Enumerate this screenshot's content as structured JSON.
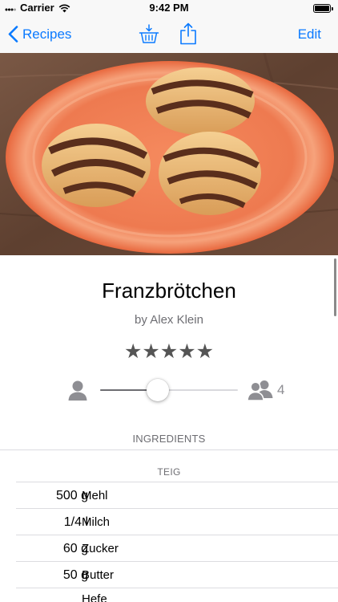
{
  "status_bar": {
    "carrier": "Carrier",
    "time": "9:42 PM"
  },
  "nav": {
    "back_label": "Recipes",
    "edit_label": "Edit"
  },
  "recipe": {
    "title": "Franzbrötchen",
    "author": "by Alex Klein",
    "stars": "★★★★★",
    "rating": 5
  },
  "servings": {
    "count": "4",
    "slider_fraction": 0.42
  },
  "ingredients": {
    "section_title": "INGREDIENTS",
    "groups": [
      {
        "name": "TEIG",
        "items": [
          {
            "amount": "500 g",
            "name": "Mehl"
          },
          {
            "amount": "1/4 l",
            "name": "Milch"
          },
          {
            "amount": "60 g",
            "name": "Zucker"
          },
          {
            "amount": "50 g",
            "name": "Butter"
          },
          {
            "amount": "",
            "name": "Hefe"
          }
        ]
      }
    ]
  },
  "colors": {
    "accent": "#0a7aff",
    "secondary_text": "#6e6e73",
    "icon_gray": "#8e8e93"
  },
  "icons": {
    "back": "chevron-left-icon",
    "basket": "basket-download-icon",
    "share": "share-icon",
    "person": "person-icon",
    "group": "people-icon",
    "signal": "wifi-icon",
    "battery": "battery-icon"
  }
}
